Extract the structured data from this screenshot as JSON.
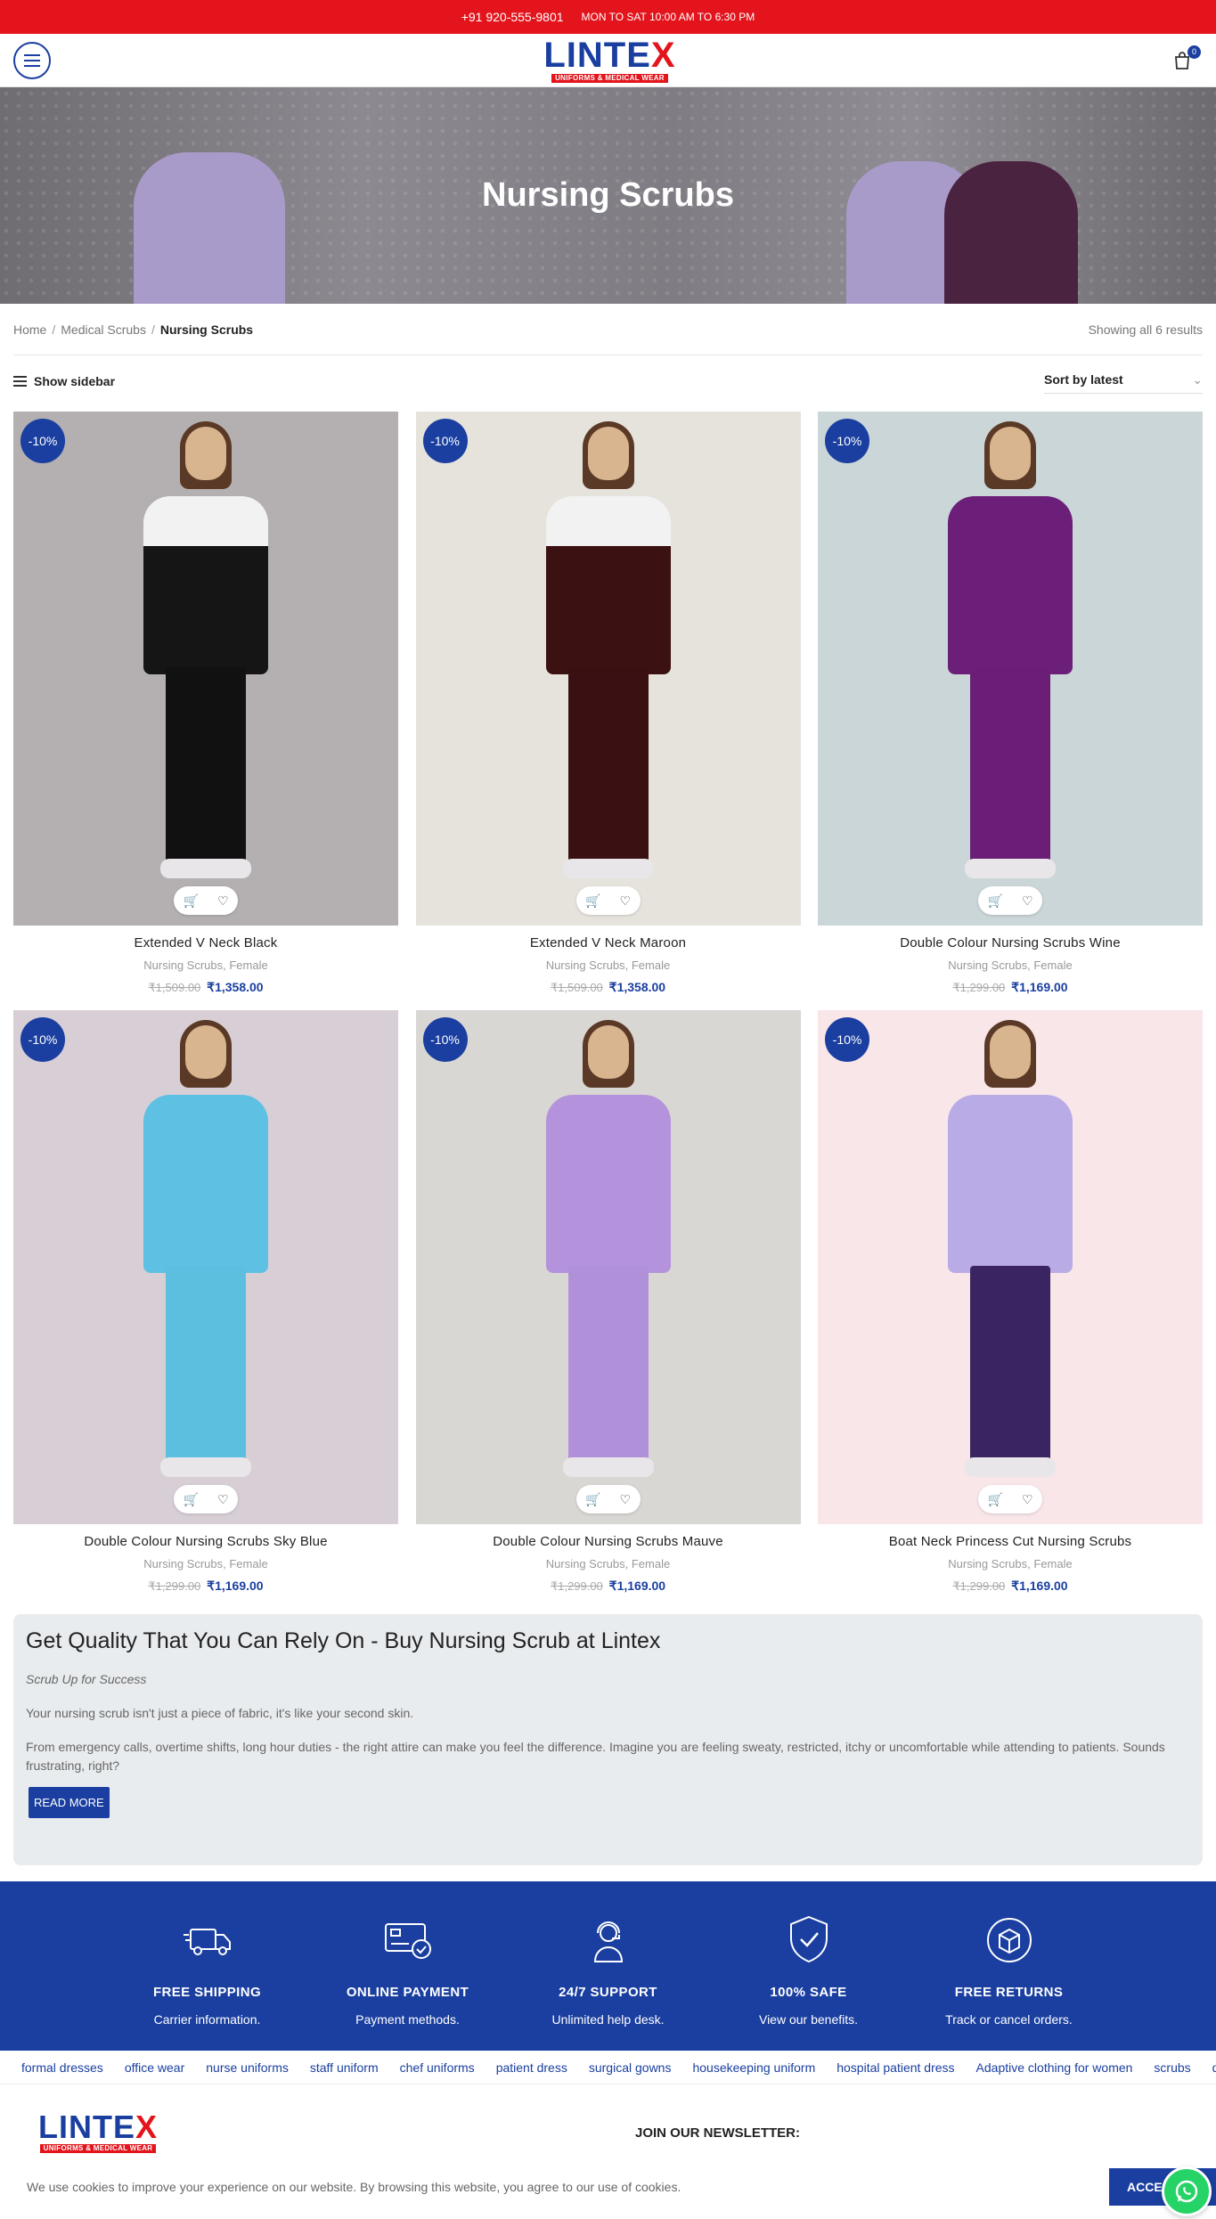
{
  "topbar": {
    "phone": "+91 920-555-9801",
    "hours": "MON TO SAT 10:00 AM TO 6:30 PM"
  },
  "header": {
    "logo_word": "LINTE",
    "logo_x": "X",
    "logo_tagline": "UNIFORMS & MEDICAL WEAR",
    "cart_count": "0"
  },
  "hero": {
    "title": "Nursing Scrubs"
  },
  "breadcrumb": {
    "items": [
      "Home",
      "Medical Scrubs",
      "Nursing Scrubs"
    ],
    "separator": "/"
  },
  "results_text": "Showing all 6 results",
  "toolbar": {
    "sidebar_label": "Show sidebar",
    "sort_label": "Sort by latest"
  },
  "products": [
    {
      "name": "Extended V Neck Black",
      "categories": "Nursing Scrubs, Female",
      "old_price": "₹1,509.00",
      "price": "₹1,358.00",
      "discount": "-10%",
      "bg": "#b4b0b1",
      "top": "#151515",
      "accent": "#f2f2f2",
      "pants": "#111111"
    },
    {
      "name": "Extended V Neck Maroon",
      "categories": "Nursing Scrubs, Female",
      "old_price": "₹1,509.00",
      "price": "₹1,358.00",
      "discount": "-10%",
      "bg": "#e6e3dc",
      "top": "#3b1112",
      "accent": "#f2f2f2",
      "pants": "#3a1012"
    },
    {
      "name": "Double Colour Nursing Scrubs Wine",
      "categories": "Nursing Scrubs, Female",
      "old_price": "₹1,299.00",
      "price": "₹1,169.00",
      "discount": "-10%",
      "bg": "#cbd6d8",
      "top": "#6c1f78",
      "accent": "#6c1f78",
      "pants": "#6a1e76"
    },
    {
      "name": "Double Colour Nursing Scrubs Sky Blue",
      "categories": "Nursing Scrubs, Female",
      "old_price": "₹1,299.00",
      "price": "₹1,169.00",
      "discount": "-10%",
      "bg": "#d8cfd6",
      "top": "#5ec0e2",
      "accent": "#5ec0e2",
      "pants": "#5cbfe0"
    },
    {
      "name": "Double Colour Nursing Scrubs Mauve",
      "categories": "Nursing Scrubs, Female",
      "old_price": "₹1,299.00",
      "price": "₹1,169.00",
      "discount": "-10%",
      "bg": "#d9d7d3",
      "top": "#b493dc",
      "accent": "#b493dc",
      "pants": "#b190da"
    },
    {
      "name": "Boat Neck Princess Cut Nursing Scrubs",
      "categories": "Nursing Scrubs, Female",
      "old_price": "₹1,299.00",
      "price": "₹1,169.00",
      "discount": "-10%",
      "bg": "#f8e6e9",
      "top": "#b9abe6",
      "accent": "#b9abe6",
      "pants": "#3a2462"
    }
  ],
  "about": {
    "heading": "Get Quality That You Can Rely On - Buy Nursing Scrub at Lintex",
    "subheading": "Scrub Up for Success",
    "para1": "Your nursing scrub isn't just a piece of fabric, it's like your second skin.",
    "para2": "From emergency calls, overtime shifts, long hour duties - the right attire can make you feel the difference. Imagine you are feeling sweaty, restricted, itchy or uncomfortable while attending to patients. Sounds frustrating, right?",
    "read_more": "READ MORE"
  },
  "features": [
    {
      "title": "FREE SHIPPING",
      "desc": "Carrier information.",
      "icon": "truck-icon"
    },
    {
      "title": "ONLINE PAYMENT",
      "desc": "Payment methods.",
      "icon": "payment-card-icon"
    },
    {
      "title": "24/7 SUPPORT",
      "desc": "Unlimited help desk.",
      "icon": "support-agent-icon"
    },
    {
      "title": "100% SAFE",
      "desc": "View our benefits.",
      "icon": "shield-check-icon"
    },
    {
      "title": "FREE RETURNS",
      "desc": "Track or cancel orders.",
      "icon": "return-box-icon"
    }
  ],
  "tags": [
    "formal dresses",
    "office wear",
    "nurse uniforms",
    "staff uniform",
    "chef uniforms",
    "patient dress",
    "surgical gowns",
    "housekeeping uniform",
    "hospital patient dress",
    "Adaptive clothing for women",
    "scrubs",
    "doctor scrubs"
  ],
  "footer": {
    "newsletter_heading": "JOIN OUR NEWSLETTER:"
  },
  "cookie": {
    "text": "We use cookies to improve your experience on our website. By browsing this website, you agree to our use of cookies.",
    "accept": "ACCEPT"
  },
  "colors": {
    "brand_blue": "#1a3fa0",
    "brand_red": "#e3141c"
  }
}
